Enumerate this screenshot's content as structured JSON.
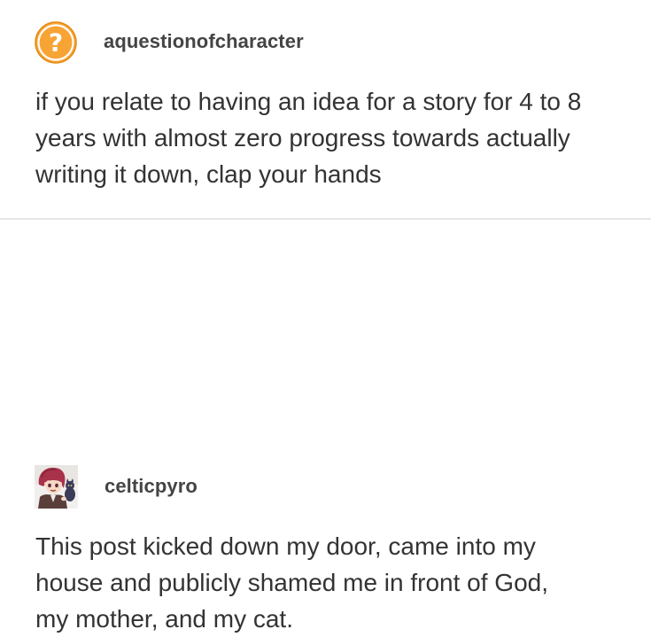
{
  "posts": [
    {
      "username": "aquestionofcharacter",
      "avatar_icon": "question-mark-icon",
      "avatar_color": "#F4A340",
      "body": "if you relate to having an idea for a story for 4 to 8\nyears with almost zero progress towards actually\nwriting it down, clap your hands"
    },
    {
      "username": "celticpyro",
      "avatar_icon": "anime-character-avatar",
      "body": "This post kicked down my door, came into my\nhouse and publicly shamed me in front of God,\nmy mother, and my cat."
    }
  ]
}
